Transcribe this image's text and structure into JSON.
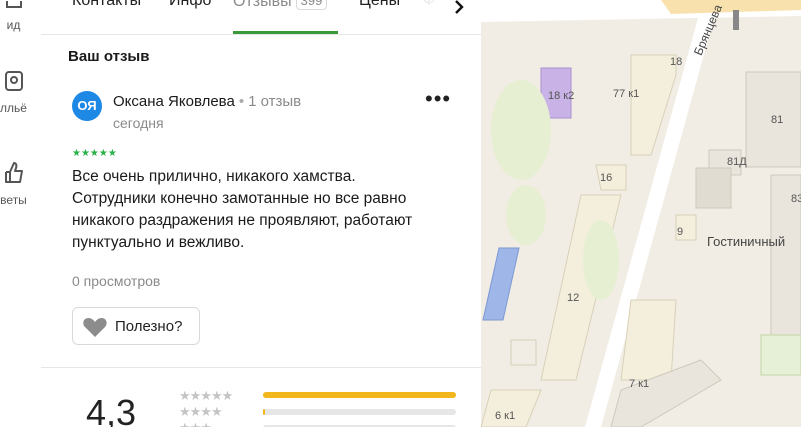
{
  "rail": {
    "items": [
      {
        "label": "ид",
        "icon": "route-icon"
      },
      {
        "label": "лльё",
        "icon": "hotel-icon"
      },
      {
        "label": "веты",
        "icon": "thumbs-up-icon"
      }
    ]
  },
  "tabs": {
    "items": [
      {
        "label": "Контакты"
      },
      {
        "label": "Инфо"
      },
      {
        "label": "Отзывы",
        "count": "399"
      },
      {
        "label": "Цены"
      },
      {
        "label": "Ф"
      }
    ],
    "active_index": 2,
    "next_icon": "chevron-right-icon"
  },
  "review": {
    "section_title": "Ваш отзыв",
    "avatar_initials": "ОЯ",
    "author": "Оксана Яковлева",
    "separator": "•",
    "author_reviews": "1 отзыв",
    "date": "сегодня",
    "more_label": "•••",
    "stars": "★★★★★",
    "rating_value": 5,
    "text": "Все очень прилично, никакого хамства. Сотрудники конечно замотанные но все равно никакого раздражения не проявляют, работают пунктуально и вежливо.",
    "views": "0 просмотров",
    "useful_label": "Полезно?"
  },
  "summary": {
    "rating": "4,3",
    "breakdown": [
      {
        "stars": "★★★★★",
        "fraction": 1.0
      },
      {
        "stars": "★★★★",
        "fraction": 0.01
      },
      {
        "stars": "★★★",
        "fraction": 0.0
      }
    ]
  },
  "map": {
    "street": "Брянцева",
    "place": "Гостиничный",
    "labels": [
      "18",
      "18 к2",
      "77 к1",
      "81",
      "81Д",
      "16",
      "9",
      "83",
      "12",
      "7 к1",
      "6 к1"
    ]
  },
  "colors": {
    "accent_green": "#3a9a3a",
    "star_green": "#2bb14a",
    "bar_fill": "#f2b71c",
    "avatar_blue": "#1e88e5"
  }
}
